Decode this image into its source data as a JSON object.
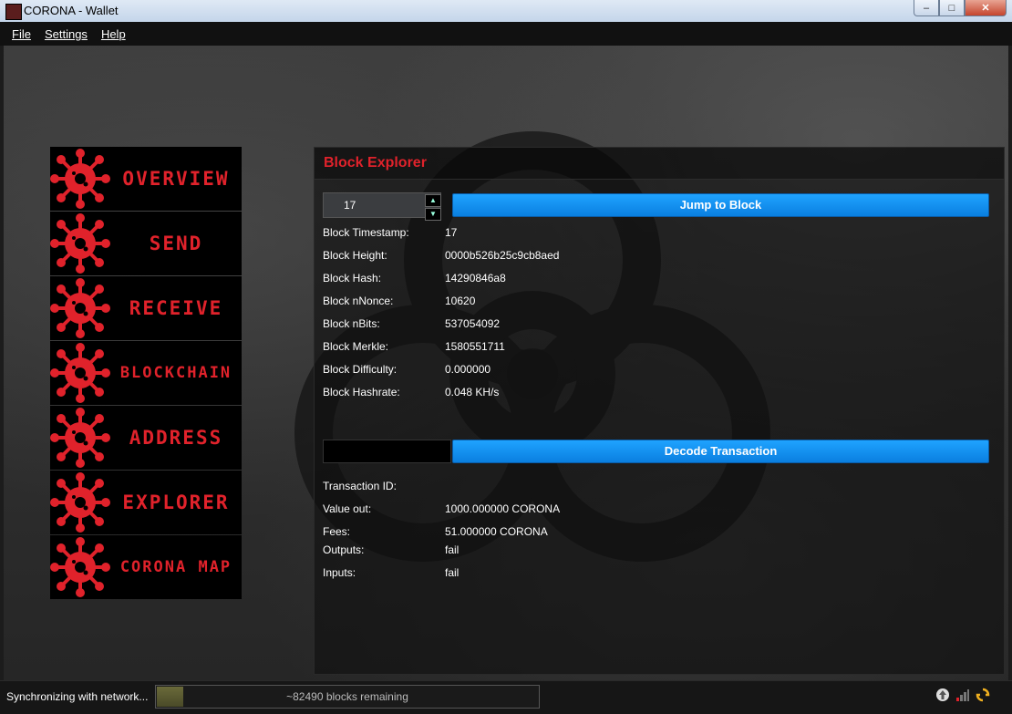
{
  "window": {
    "title": "CORONA - Wallet"
  },
  "menu": [
    "File",
    "Settings",
    "Help"
  ],
  "sidebar": {
    "items": [
      {
        "label": "OVERVIEW"
      },
      {
        "label": "SEND"
      },
      {
        "label": "RECEIVE"
      },
      {
        "label": "BLOCKCHAIN"
      },
      {
        "label": "ADDRESS"
      },
      {
        "label": "EXPLORER"
      },
      {
        "label": "CORONA MAP"
      }
    ]
  },
  "explorer": {
    "title": "Block Explorer",
    "block_number": "17",
    "jump_label": "Jump to Block",
    "block_rows": [
      {
        "label": "Block Timestamp:",
        "value": "17"
      },
      {
        "label": "Block Height:",
        "value": "0000b526b25c9cb8aed"
      },
      {
        "label": "Block Hash:",
        "value": "14290846a8"
      },
      {
        "label": "Block nNonce:",
        "value": "10620"
      },
      {
        "label": "Block nBits:",
        "value": "537054092"
      },
      {
        "label": "Block Merkle:",
        "value": "1580551711"
      },
      {
        "label": "Block Difficulty:",
        "value": "0.000000"
      },
      {
        "label": "Block Hashrate:",
        "value": "0.048 KH/s"
      }
    ],
    "decode_label": "Decode Transaction",
    "tx_input_value": "",
    "tx_rows": [
      {
        "label": "Transaction ID:",
        "value": ""
      },
      {
        "label": "Value out:",
        "value": "1000.000000 CORONA"
      },
      {
        "label": "Fees:",
        "value": "51.000000 CORONA"
      },
      {
        "label": "Outputs:",
        "value": "fail"
      },
      {
        "label": "Inputs:",
        "value": "fail"
      }
    ]
  },
  "status": {
    "sync_text": "Synchronizing with network...",
    "progress_text": "~82490 blocks remaining",
    "progress_fraction": 0.07
  },
  "colors": {
    "accent": "#e0222b",
    "button": "#1296f3"
  }
}
